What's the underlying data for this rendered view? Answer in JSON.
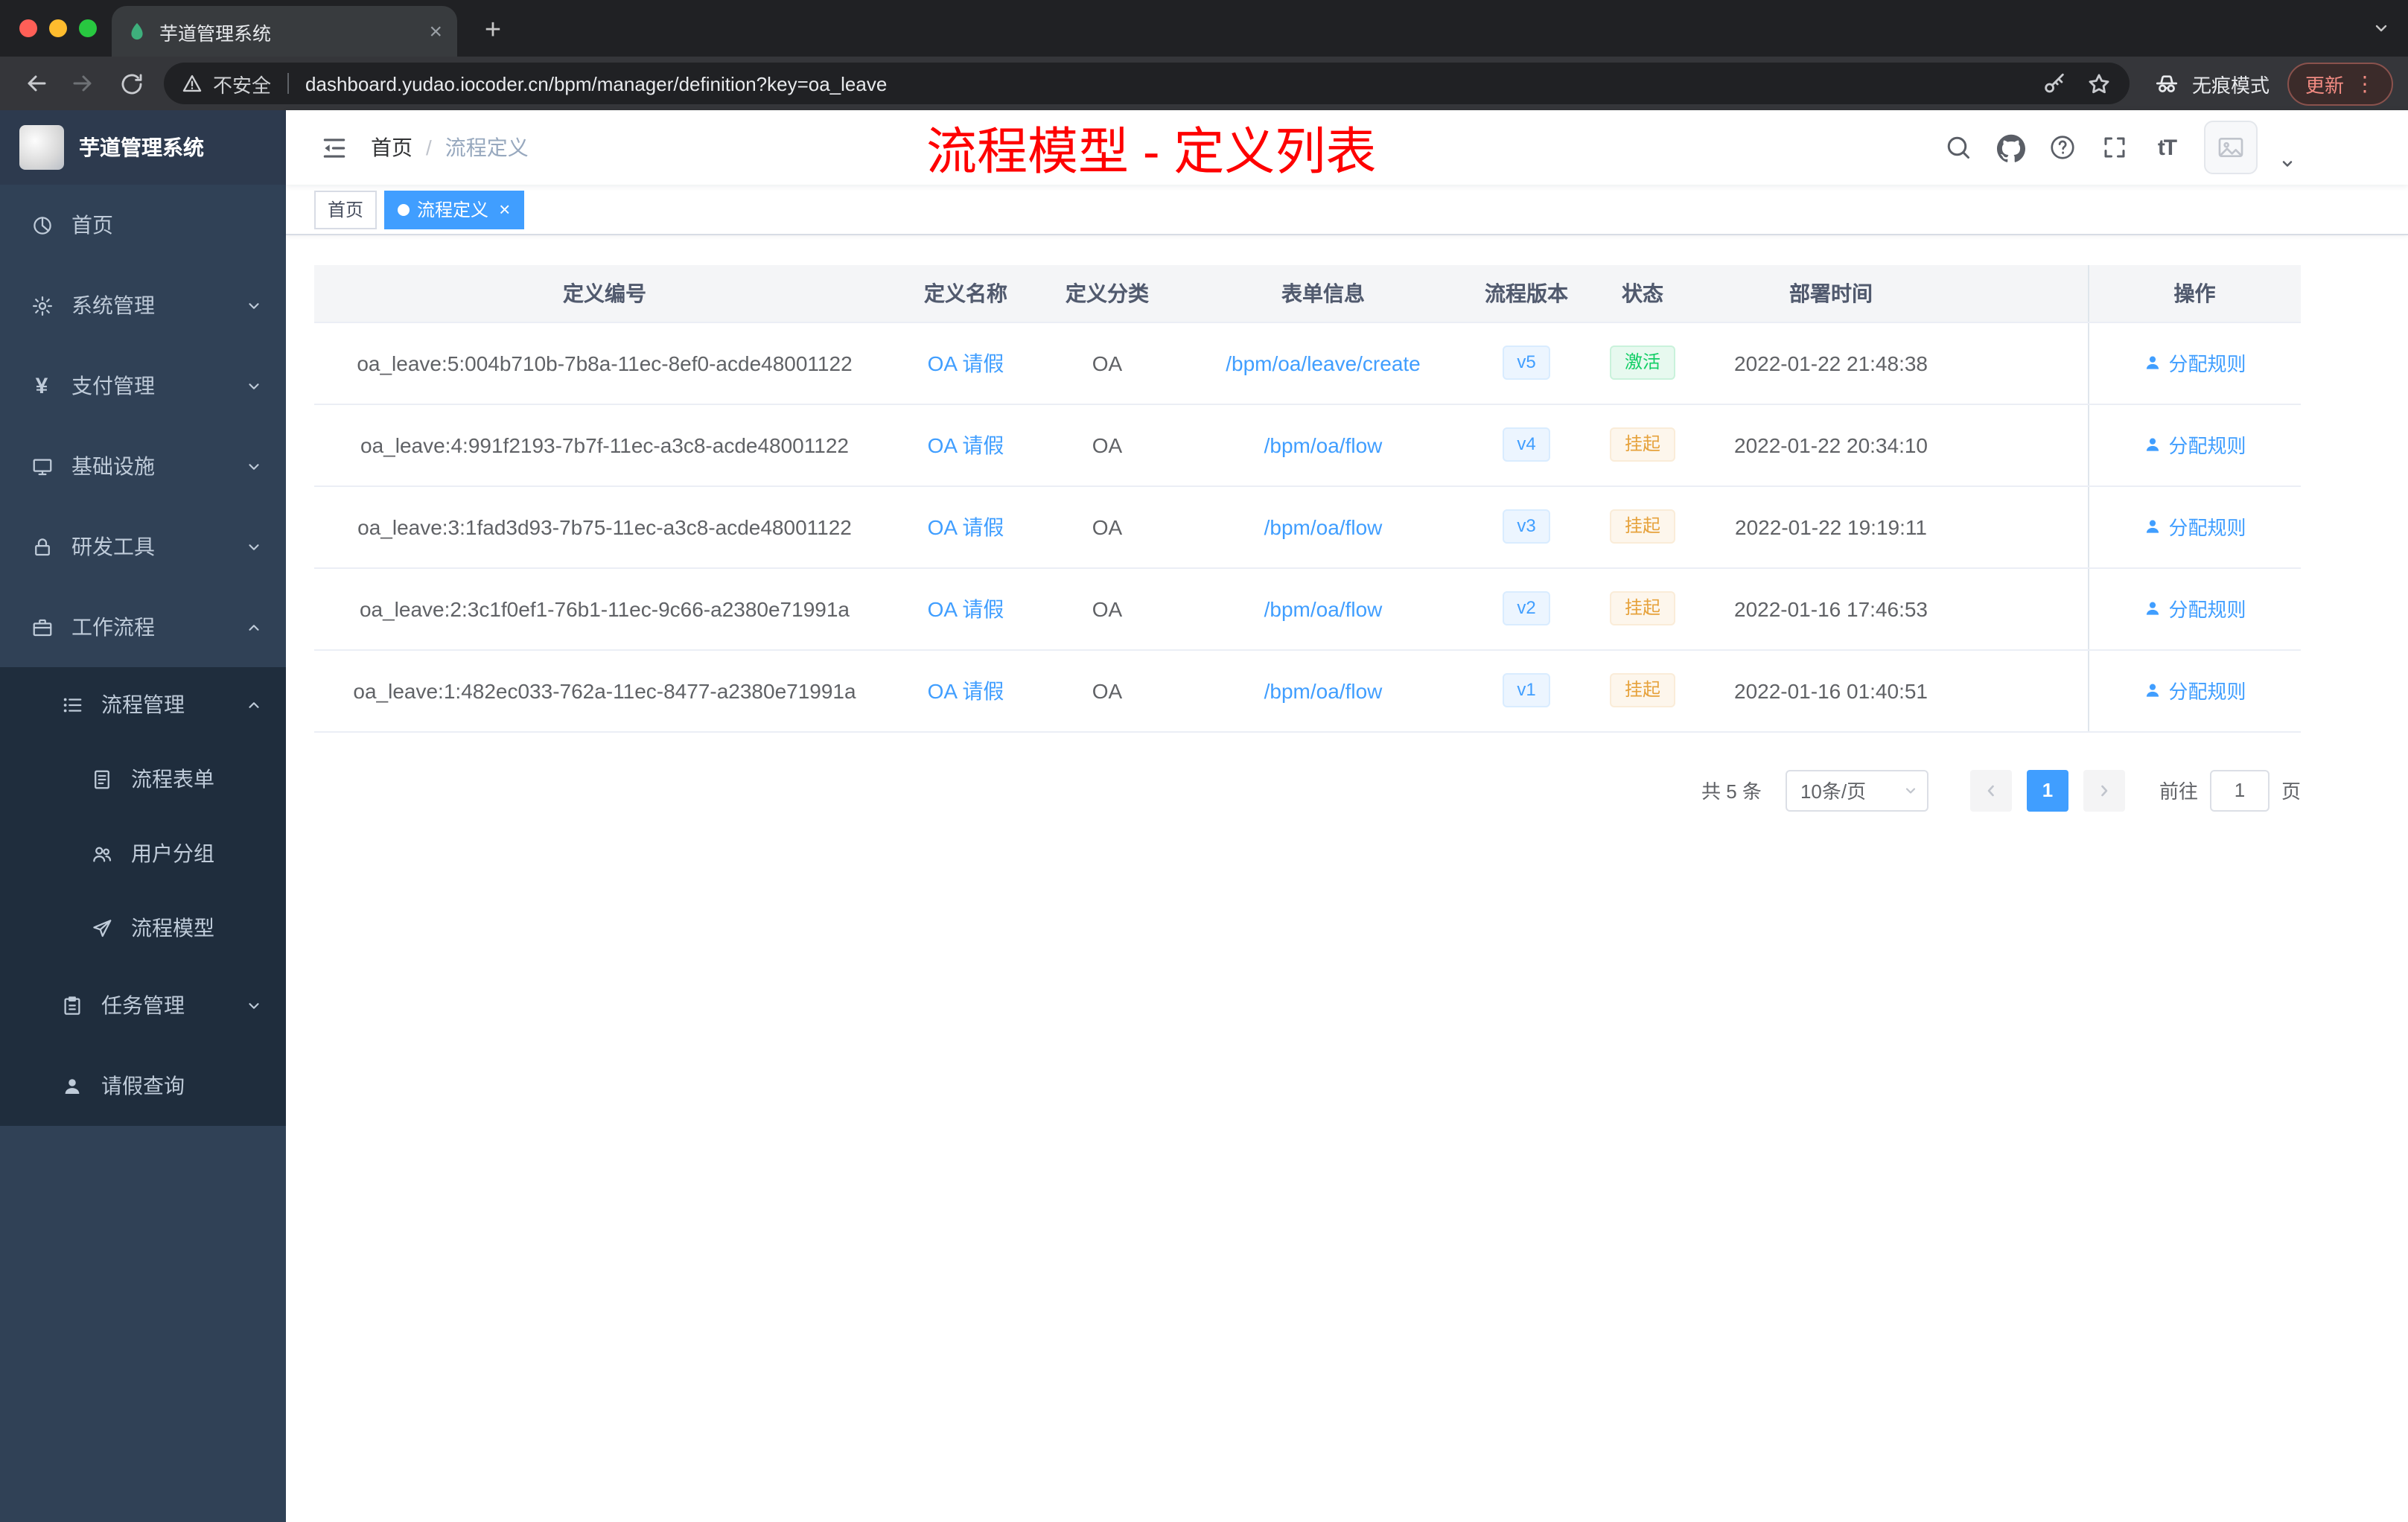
{
  "browser": {
    "tab": {
      "title": "芋道管理系统",
      "favicon": "leaf-icon"
    },
    "toolbar": {
      "security_label": "不安全",
      "url": "dashboard.yudao.iocoder.cn/bpm/manager/definition?key=oa_leave",
      "incognito_label": "无痕模式",
      "update_label": "更新"
    }
  },
  "sidebar": {
    "logo_title": "芋道管理系统",
    "menu": [
      {
        "label": "首页",
        "icon": "dashboard-icon",
        "expandable": false
      },
      {
        "label": "系统管理",
        "icon": "gear-icon",
        "expandable": true
      },
      {
        "label": "支付管理",
        "icon": "yen-icon",
        "expandable": true
      },
      {
        "label": "基础设施",
        "icon": "monitor-icon",
        "expandable": true
      },
      {
        "label": "研发工具",
        "icon": "lock-icon",
        "expandable": true
      },
      {
        "label": "工作流程",
        "icon": "briefcase-icon",
        "expandable": true,
        "expanded": true
      }
    ],
    "workflow_submenu": {
      "parent": {
        "label": "流程管理",
        "icon": "list-icon",
        "expanded": true
      },
      "children": [
        {
          "label": "流程表单",
          "icon": "document-icon"
        },
        {
          "label": "用户分组",
          "icon": "users-icon"
        },
        {
          "label": "流程模型",
          "icon": "send-icon"
        }
      ],
      "siblings": [
        {
          "label": "任务管理",
          "icon": "clipboard-icon",
          "expandable": true
        },
        {
          "label": "请假查询",
          "icon": "user-icon",
          "expandable": false
        }
      ]
    }
  },
  "header": {
    "breadcrumb": {
      "home": "首页",
      "separator": "/",
      "current": "流程定义"
    },
    "annotation": "流程模型 - 定义列表",
    "font_size_glyph": "tT",
    "icons": [
      "search-icon",
      "github-icon",
      "question-icon",
      "fullscreen-icon",
      "font-size-icon",
      "avatar",
      "caret-down-icon"
    ]
  },
  "tags": {
    "items": [
      {
        "label": "首页",
        "active": false,
        "closable": false
      },
      {
        "label": "流程定义",
        "active": true,
        "closable": true
      }
    ]
  },
  "table": {
    "columns": [
      "定义编号",
      "定义名称",
      "定义分类",
      "表单信息",
      "流程版本",
      "状态",
      "部署时间",
      "操作"
    ],
    "rows": [
      {
        "id": "oa_leave:5:004b710b-7b8a-11ec-8ef0-acde48001122",
        "name": "OA 请假",
        "category": "OA",
        "form": "/bpm/oa/leave/create",
        "version": "v5",
        "status": "激活",
        "status_type": "success",
        "time": "2022-01-22 21:48:38",
        "action": "分配规则"
      },
      {
        "id": "oa_leave:4:991f2193-7b7f-11ec-a3c8-acde48001122",
        "name": "OA 请假",
        "category": "OA",
        "form": "/bpm/oa/flow",
        "version": "v4",
        "status": "挂起",
        "status_type": "warning",
        "time": "2022-01-22 20:34:10",
        "action": "分配规则"
      },
      {
        "id": "oa_leave:3:1fad3d93-7b75-11ec-a3c8-acde48001122",
        "name": "OA 请假",
        "category": "OA",
        "form": "/bpm/oa/flow",
        "version": "v3",
        "status": "挂起",
        "status_type": "warning",
        "time": "2022-01-22 19:19:11",
        "action": "分配规则"
      },
      {
        "id": "oa_leave:2:3c1f0ef1-76b1-11ec-9c66-a2380e71991a",
        "name": "OA 请假",
        "category": "OA",
        "form": "/bpm/oa/flow",
        "version": "v2",
        "status": "挂起",
        "status_type": "warning",
        "time": "2022-01-16 17:46:53",
        "action": "分配规则"
      },
      {
        "id": "oa_leave:1:482ec033-762a-11ec-8477-a2380e71991a",
        "name": "OA 请假",
        "category": "OA",
        "form": "/bpm/oa/flow",
        "version": "v1",
        "status": "挂起",
        "status_type": "warning",
        "time": "2022-01-16 01:40:51",
        "action": "分配规则"
      }
    ]
  },
  "pagination": {
    "total_label": "共 5 条",
    "page_size": "10条/页",
    "current_page": "1",
    "goto_label": "前往",
    "goto_value": "1",
    "page_unit": "页"
  },
  "colors": {
    "accent": "#409eff",
    "success": "#13ce66",
    "warning": "#e6a23c",
    "annotation_red": "#fe0000",
    "sidebar_bg": "#304156",
    "submenu_bg": "#1f2d3d"
  }
}
